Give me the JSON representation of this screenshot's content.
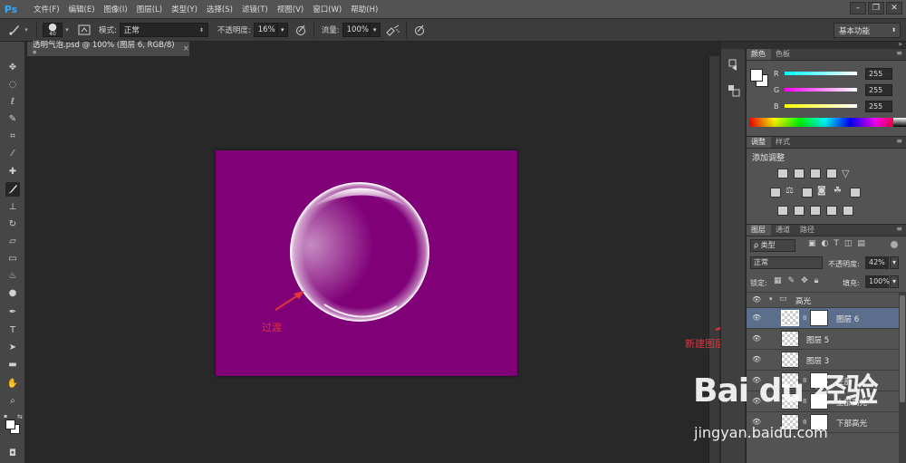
{
  "app": {
    "logo": "Ps",
    "menu": [
      "文件(F)",
      "编辑(E)",
      "图像(I)",
      "图层(L)",
      "类型(Y)",
      "选择(S)",
      "滤镜(T)",
      "视图(V)",
      "窗口(W)",
      "帮助(H)"
    ],
    "window_controls": [
      "–",
      "❐",
      "✕"
    ]
  },
  "options": {
    "brush_size": "40",
    "mode_label": "模式:",
    "mode_value": "正常",
    "opacity_label": "不透明度:",
    "opacity_value": "16%",
    "flow_label": "流量:",
    "flow_value": "100%",
    "workspace": "基本功能"
  },
  "document": {
    "tab_title": "透明气泡.psd @ 100% (图层 6, RGB/8) *",
    "close": "×",
    "canvas_color": "#800078"
  },
  "annotations": {
    "transition": "过渡",
    "new_layer": "新建图层"
  },
  "color_panel": {
    "tabs": [
      "颜色",
      "色板"
    ],
    "channels": [
      {
        "label": "R",
        "value": "255"
      },
      {
        "label": "G",
        "value": "255"
      },
      {
        "label": "B",
        "value": "255"
      }
    ]
  },
  "adjust_panel": {
    "tabs": [
      "调整",
      "样式"
    ],
    "title": "添加调整"
  },
  "layers_panel": {
    "tabs": [
      "图层",
      "通道",
      "路径"
    ],
    "filter": "ρ 类型",
    "blend_mode": "正常",
    "opacity_label": "不透明度:",
    "opacity_value": "42%",
    "lock_label": "锁定:",
    "fill_label": "填充:",
    "fill_value": "100%",
    "group_name": "高光",
    "layers": [
      {
        "name": "图层 6",
        "selected": true,
        "mask": true
      },
      {
        "name": "图层 5",
        "selected": false,
        "mask": false
      },
      {
        "name": "图层 3",
        "selected": false,
        "mask": false
      },
      {
        "name": "左部",
        "selected": false,
        "mask": true
      },
      {
        "name": "上部高光",
        "selected": false,
        "mask": true
      },
      {
        "name": "下部高光",
        "selected": false,
        "mask": true
      }
    ]
  },
  "watermark": {
    "brand": "Bai du 经验",
    "url": "jingyan.baidu.com"
  }
}
